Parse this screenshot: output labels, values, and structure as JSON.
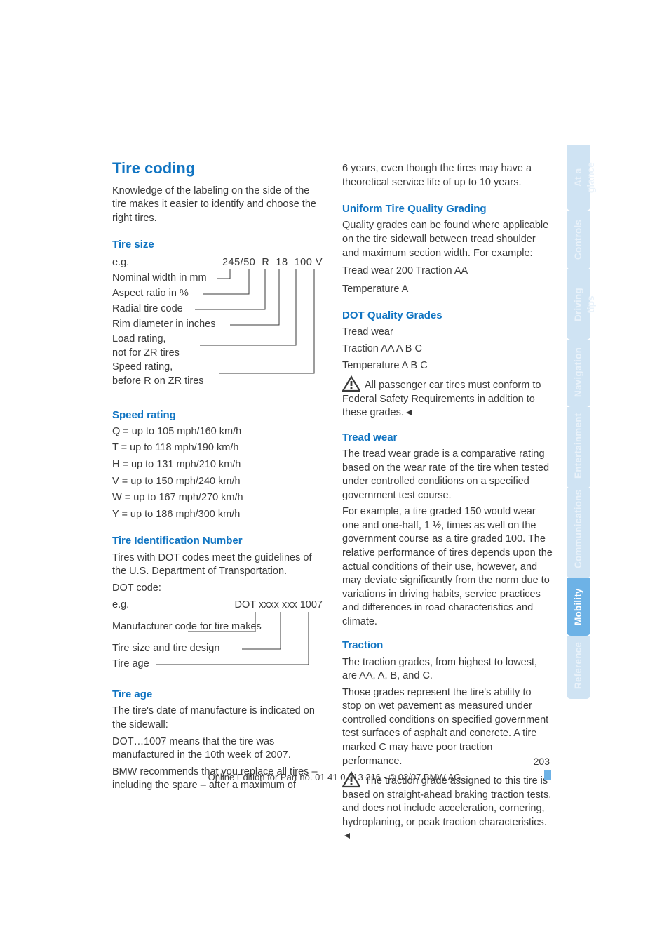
{
  "tabs": [
    {
      "label": "At a glance"
    },
    {
      "label": "Controls"
    },
    {
      "label": "Driving tips"
    },
    {
      "label": "Navigation"
    },
    {
      "label": "Entertainment"
    },
    {
      "label": "Communications"
    },
    {
      "label": "Mobility"
    },
    {
      "label": "Reference"
    }
  ],
  "left": {
    "h1": "Tire coding",
    "intro": "Knowledge of the labeling on the side of the tire makes it easier to identify and choose the right tires.",
    "tire_size": {
      "heading": "Tire size",
      "eg": "e.g.",
      "value": "245/50  R  18  100 V",
      "rows": [
        "Nominal width in mm",
        "Aspect ratio in %",
        "Radial tire code",
        "Rim diameter in inches",
        "Load rating,\nnot for ZR tires",
        "Speed rating,\nbefore R on ZR tires"
      ]
    },
    "speed": {
      "heading": "Speed rating",
      "rows": [
        "Q  = up to 105 mph/160 km/h",
        "T   = up to 118 mph/190 km/h",
        "H  = up to 131 mph/210 km/h",
        "V  = up to 150 mph/240 km/h",
        "W = up to 167 mph/270 km/h",
        "Y  = up to 186 mph/300 km/h"
      ]
    },
    "tin": {
      "heading": "Tire Identification Number",
      "p1": "Tires with DOT codes meet the guidelines of the U.S. Department of Transportation.",
      "p2": "DOT code:",
      "eg": "e.g.",
      "value": "DOT xxxx xxx 1007",
      "rows": [
        "Manufacturer code\nfor tire makes",
        "Tire size and tire design",
        "Tire age"
      ]
    },
    "tire_age": {
      "heading": "Tire age",
      "p1": "The tire's date of manufacture is indicated on the sidewall:",
      "p2": "DOT…1007 means that the tire was manufactured in the 10th week of 2007.",
      "p3": "BMW recommends that you replace all tires – including the spare – after a maximum of"
    }
  },
  "right": {
    "cont": "6 years, even though the tires may have a theoretical service life of up to 10 years.",
    "utqg": {
      "heading": "Uniform Tire Quality Grading",
      "p1": "Quality grades can be found where applicable on the tire sidewall between tread shoulder and maximum section width. For example:",
      "p2": "Tread wear 200 Traction AA",
      "p3": "Temperature A"
    },
    "dotq": {
      "heading": "DOT Quality Grades",
      "p1": "Tread wear",
      "p2": "Traction AA A B C",
      "p3": "Temperature A B C",
      "warn": "All passenger car tires must conform to Federal Safety Requirements in addition to these grades."
    },
    "tread": {
      "heading": "Tread wear",
      "p1": "The tread wear grade is a comparative rating based on the wear rate of the tire when tested under controlled conditions on a specified government test course.",
      "p2": "For example, a tire graded 150 would wear one and one-half, 1 ½, times as well on the government course as a tire graded 100. The relative performance of tires depends upon the actual conditions of their use, however, and may deviate significantly from the norm due to variations in driving habits, service practices and differences in road characteristics and climate."
    },
    "traction": {
      "heading": "Traction",
      "p1": "The traction grades, from highest to lowest, are AA, A, B, and C.",
      "p2": "Those grades represent the tire's ability to stop on wet pavement as measured under controlled conditions on specified government test surfaces of asphalt and concrete. A tire marked C may have poor traction performance.",
      "warn": "The traction grade assigned to this tire is based on straight-ahead braking traction tests, and does not include acceleration, cornering, hydroplaning, or peak traction characteristics."
    }
  },
  "page_number": "203",
  "footer": "Online Edition for Part no. 01 41 0 013 316 - © 02/07 BMW AG"
}
